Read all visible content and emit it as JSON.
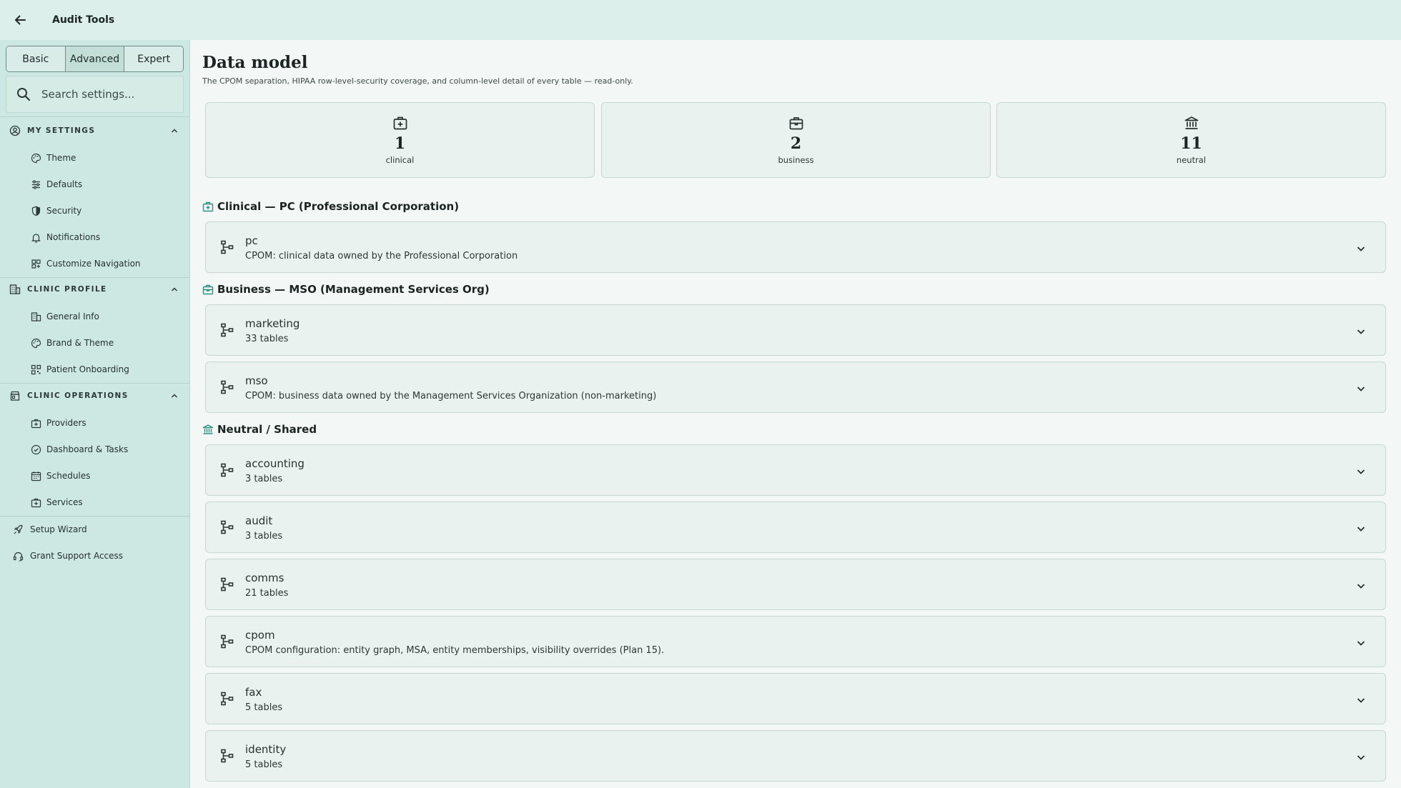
{
  "topbar": {
    "title": "Audit Tools",
    "back_icon": "arrow-left-icon"
  },
  "sidebar": {
    "modes": [
      {
        "label": "Basic",
        "active": false
      },
      {
        "label": "Advanced",
        "active": true
      },
      {
        "label": "Expert",
        "active": false
      }
    ],
    "search": {
      "placeholder": "Search settings..."
    },
    "sections": [
      {
        "label": "MY SETTINGS",
        "icon": "user-circle-icon",
        "items": [
          {
            "label": "Theme",
            "icon": "palette-icon"
          },
          {
            "label": "Defaults",
            "icon": "sliders-icon"
          },
          {
            "label": "Security",
            "icon": "shield-icon"
          },
          {
            "label": "Notifications",
            "icon": "bell-icon"
          },
          {
            "label": "Customize Navigation",
            "icon": "grid-icon"
          }
        ]
      },
      {
        "label": "CLINIC PROFILE",
        "icon": "building-icon",
        "items": [
          {
            "label": "General Info",
            "icon": "building-icon"
          },
          {
            "label": "Brand & Theme",
            "icon": "palette-icon"
          },
          {
            "label": "Patient Onboarding",
            "icon": "qr-icon"
          }
        ]
      },
      {
        "label": "CLINIC OPERATIONS",
        "icon": "store-icon",
        "items": [
          {
            "label": "Providers",
            "icon": "medical-bag-icon"
          },
          {
            "label": "Dashboard & Tasks",
            "icon": "check-circle-icon"
          },
          {
            "label": "Schedules",
            "icon": "calendar-icon"
          },
          {
            "label": "Services",
            "icon": "medical-bag-icon"
          }
        ]
      }
    ],
    "extras": [
      {
        "label": "Setup Wizard",
        "icon": "rocket-icon"
      },
      {
        "label": "Grant Support Access",
        "icon": "headset-icon"
      }
    ]
  },
  "main": {
    "title": "Data model",
    "subtitle": "The CPOM separation, HIPAA row-level-security coverage, and column-level detail of every table — read-only.",
    "stats": [
      {
        "value": "1",
        "label": "clinical",
        "icon": "medical-bag-icon"
      },
      {
        "value": "2",
        "label": "business",
        "icon": "briefcase-icon"
      },
      {
        "value": "11",
        "label": "neutral",
        "icon": "bank-icon"
      }
    ],
    "groups": [
      {
        "heading": "Clinical — PC (Professional Corporation)",
        "icon": "medical-bag-icon",
        "schemas": [
          {
            "name": "pc",
            "desc": "CPOM: clinical data owned by the Professional Corporation"
          }
        ]
      },
      {
        "heading": "Business — MSO (Management Services Org)",
        "icon": "briefcase-icon",
        "schemas": [
          {
            "name": "marketing",
            "desc": "33 tables"
          },
          {
            "name": "mso",
            "desc": "CPOM: business data owned by the Management Services Organization (non-marketing)"
          }
        ]
      },
      {
        "heading": "Neutral / Shared",
        "icon": "bank-icon",
        "schemas": [
          {
            "name": "accounting",
            "desc": "3 tables"
          },
          {
            "name": "audit",
            "desc": "3 tables"
          },
          {
            "name": "comms",
            "desc": "21 tables"
          },
          {
            "name": "cpom",
            "desc": "CPOM configuration: entity graph, MSA, entity memberships, visibility overrides (Plan 15)."
          },
          {
            "name": "fax",
            "desc": "5 tables"
          },
          {
            "name": "identity",
            "desc": "5 tables"
          }
        ]
      }
    ]
  },
  "colors": {
    "accent": "#2f8f80",
    "sidebar_bg": "#cde8e2",
    "topbar_bg": "#dcefea",
    "card_bg": "#eaf2f0"
  }
}
